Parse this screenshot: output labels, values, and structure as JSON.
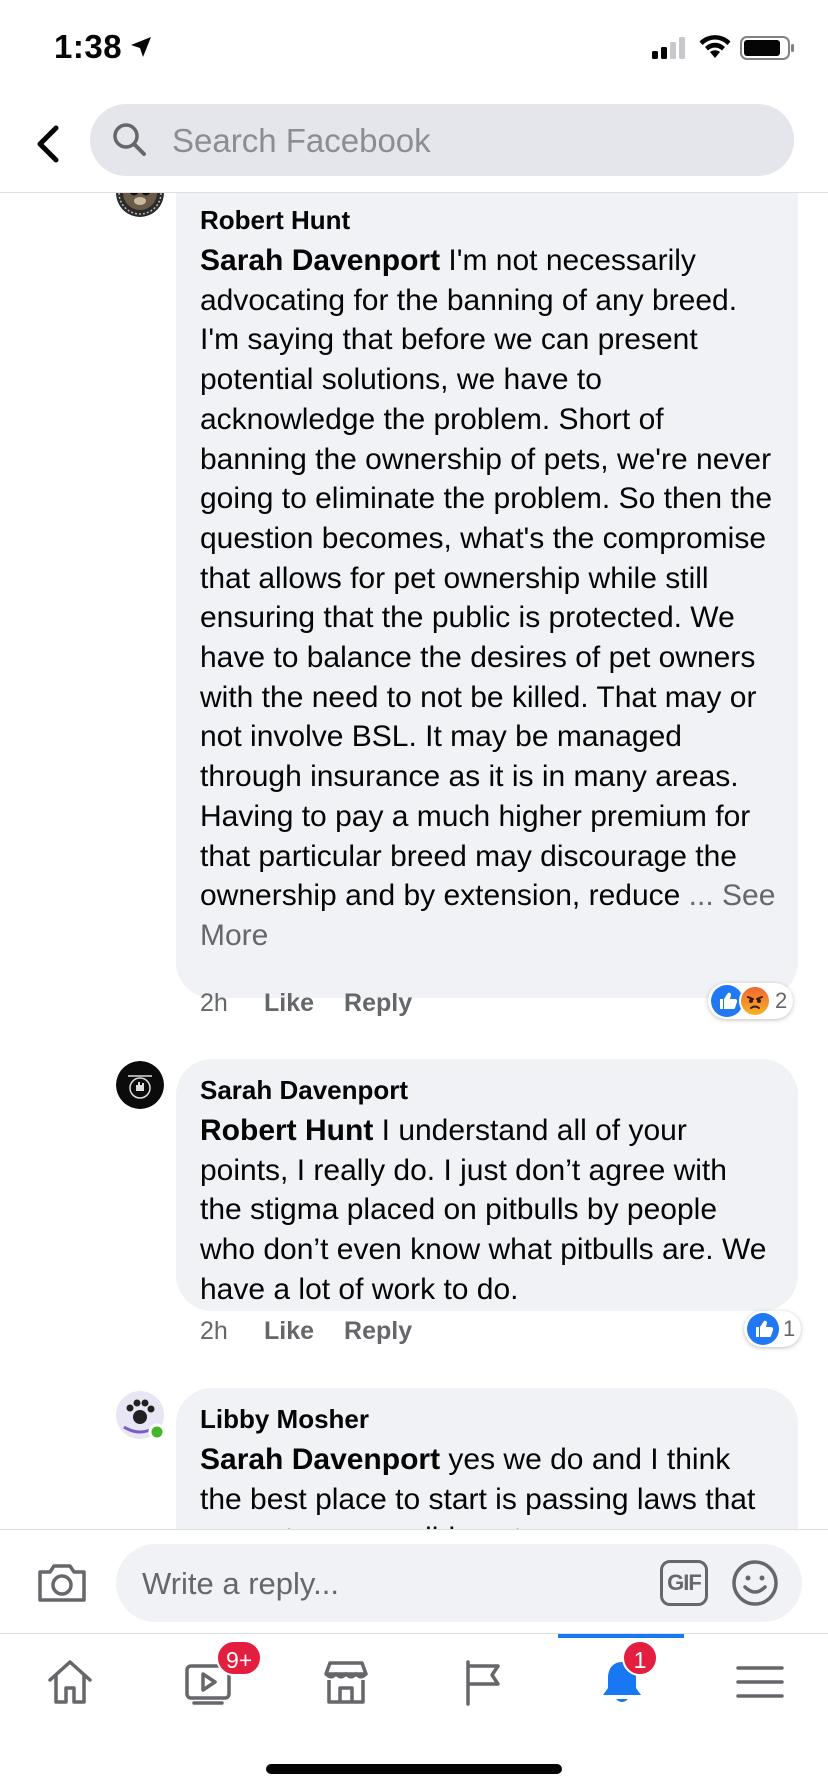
{
  "status_bar": {
    "time": "1:38"
  },
  "search": {
    "placeholder": "Search Facebook"
  },
  "comments": [
    {
      "author": "Robert Hunt",
      "mention": "Sarah Davenport",
      "text": " I'm not necessarily advocating for the banning of any breed. I'm saying that before we can present potential solutions, we have to acknowledge the problem. Short of banning the ownership of pets, we're never going to eliminate the problem. So then the question becomes, what's the compromise that allows for pet ownership while still ensuring that the public is protected. We have to balance the desires of pet owners with the need to not be killed. That may or not involve BSL. It may be managed through insurance as it is in many areas. Having to pay a much higher premium for that particular breed may discourage the ownership and by extension, reduce ",
      "see_more": "... See More",
      "time": "2h",
      "like": "Like",
      "reply": "Reply",
      "reaction_count": "2",
      "reactions": [
        "like",
        "angry"
      ]
    },
    {
      "author": "Sarah Davenport",
      "mention": "Robert Hunt",
      "text": " I understand all of your points, I really do. I just don’t agree with the stigma placed on pitbulls by people who don’t even know what pitbulls are. We have a lot of work to do.",
      "time": "2h",
      "like": "Like",
      "reply": "Reply",
      "reaction_count": "1",
      "reactions": [
        "like"
      ]
    },
    {
      "author": "Libby Mosher",
      "mention": "Sarah Davenport",
      "text": " yes we do and I think the best place to start is passing laws that promote responsible pet"
    }
  ],
  "compose": {
    "placeholder": "Write a reply...",
    "gif_label": "GIF"
  },
  "tab_bar": {
    "active": "notifications",
    "watch_badge": "9+",
    "notifications_badge": "1"
  },
  "colors": {
    "accent": "#1877f2",
    "badge": "#e41e3f",
    "bubble": "#f0f2f5"
  }
}
